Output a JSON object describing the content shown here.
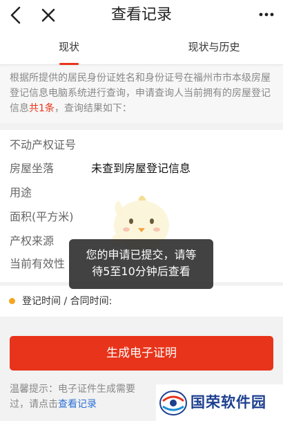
{
  "header": {
    "title": "查看记录",
    "back_icon": "back-chevron-icon",
    "close_icon": "close-icon",
    "more_icon": "more-dots-icon"
  },
  "tabs": [
    {
      "label": "现状",
      "active": true
    },
    {
      "label": "现状与历史",
      "active": false
    }
  ],
  "notice": {
    "before": "根据所提供的居民身份证姓名和身份证号在福州市市本级房屋登记信息电脑系统进行查询，申请查询人当前拥有的房屋登记信息",
    "highlight": "共1条",
    "after": "，查询结果如下："
  },
  "fields": [
    "不动产权证号",
    "房屋坐落",
    "用途",
    "面积(平方米)",
    "产权来源",
    "当前有效性"
  ],
  "result_text": "未查到房屋登记信息",
  "toast": {
    "line1": "您的申请已提交，请等",
    "line2": "待5至10分钟后查看"
  },
  "register_time_label": "登记时间 / 合同时间:",
  "generate_button": "生成电子证明",
  "tip": {
    "line1": "温馨提示：电子证件生成需要",
    "line2_prefix": "过，请点击",
    "link": "查看记录"
  },
  "watermark": {
    "text": "国荣软件园"
  },
  "colors": {
    "accent": "#e8341a",
    "dot": "#f4a623",
    "link": "#2a6fd6"
  }
}
